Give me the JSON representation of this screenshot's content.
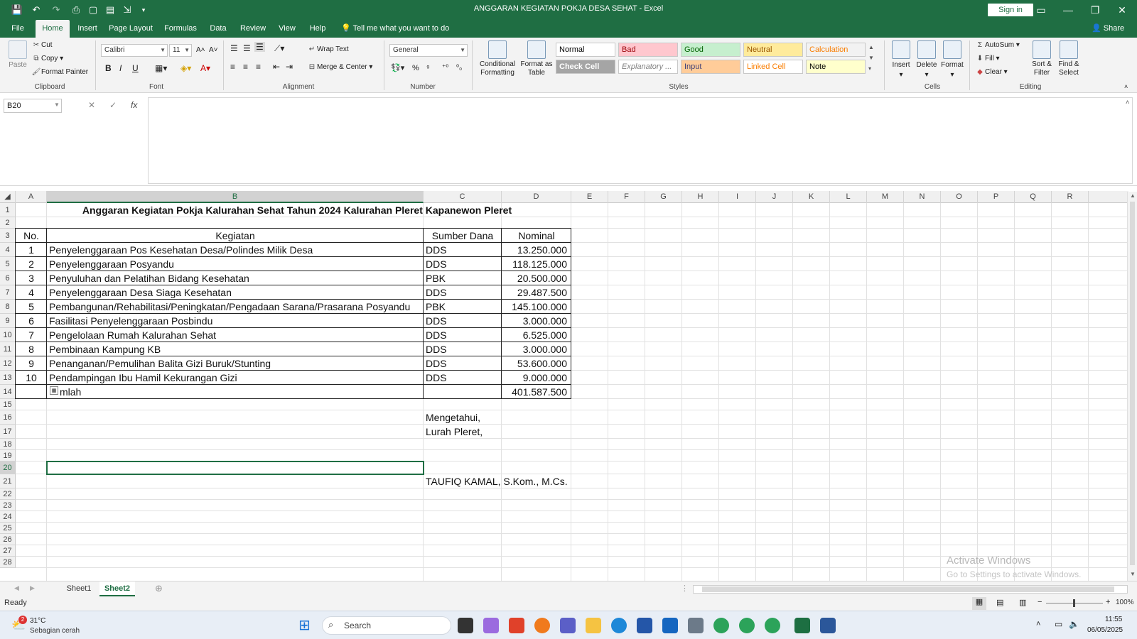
{
  "titlebar": {
    "title": "ANGGARAN KEGIATAN POKJA DESA SEHAT  -  Excel",
    "signin": "Sign in"
  },
  "tabs": [
    "File",
    "Home",
    "Insert",
    "Page Layout",
    "Formulas",
    "Data",
    "Review",
    "View",
    "Help"
  ],
  "active_tab": "Home",
  "tellme": "Tell me what you want to do",
  "share": "Share",
  "ribbon": {
    "clipboard": {
      "label": "Clipboard",
      "paste": "Paste",
      "cut": "Cut",
      "copy": "Copy",
      "format_painter": "Format Painter"
    },
    "font": {
      "label": "Font",
      "name": "Calibri",
      "size": "11",
      "bold": "B",
      "italic": "I",
      "underline": "U"
    },
    "alignment": {
      "label": "Alignment",
      "wrap": "Wrap Text",
      "merge": "Merge & Center"
    },
    "number": {
      "label": "Number",
      "format": "General"
    },
    "styles": {
      "label": "Styles",
      "conditional": "Conditional Formatting",
      "format_table": "Format as Table",
      "cells": [
        {
          "name": "Normal",
          "bg": "#ffffff",
          "color": "#000000"
        },
        {
          "name": "Bad",
          "bg": "#ffc7ce",
          "color": "#9c0006"
        },
        {
          "name": "Good",
          "bg": "#c6efce",
          "color": "#006100"
        },
        {
          "name": "Neutral",
          "bg": "#ffeb9c",
          "color": "#9c5700"
        },
        {
          "name": "Calculation",
          "bg": "#f2f2f2",
          "color": "#fa7d00"
        },
        {
          "name": "Check Cell",
          "bg": "#a5a5a5",
          "color": "#ffffff"
        },
        {
          "name": "Explanatory ...",
          "bg": "#ffffff",
          "color": "#7f7f7f"
        },
        {
          "name": "Input",
          "bg": "#ffcc99",
          "color": "#3f3f76"
        },
        {
          "name": "Linked Cell",
          "bg": "#ffffff",
          "color": "#fa7d00"
        },
        {
          "name": "Note",
          "bg": "#ffffcc",
          "color": "#000000"
        }
      ]
    },
    "cells": {
      "label": "Cells",
      "insert": "Insert",
      "delete": "Delete",
      "format": "Format"
    },
    "editing": {
      "label": "Editing",
      "autosum": "AutoSum",
      "fill": "Fill",
      "clear": "Clear",
      "sort": "Sort & Filter",
      "find": "Find & Select"
    }
  },
  "namebox": "B20",
  "columns": [
    "A",
    "B",
    "C",
    "D",
    "E",
    "F",
    "G",
    "H",
    "I",
    "J",
    "K",
    "L",
    "M",
    "N",
    "O",
    "P",
    "Q",
    "R"
  ],
  "selected_col": "B",
  "selected_row": 20,
  "rows": [
    "1",
    "2",
    "3",
    "4",
    "5",
    "6",
    "7",
    "8",
    "9",
    "10",
    "11",
    "12",
    "13",
    "14",
    "15",
    "16",
    "17",
    "18",
    "19",
    "20",
    "21",
    "22",
    "23",
    "24",
    "25",
    "26",
    "27",
    "28"
  ],
  "sheet": {
    "title": "Anggaran Kegiatan Pokja Kalurahan Sehat Tahun 2024 Kalurahan Pleret Kapanewon Pleret",
    "headers": {
      "no": "No.",
      "kegiatan": "Kegiatan",
      "sumber": "Sumber Dana",
      "nominal": "Nominal"
    },
    "items": [
      {
        "no": "1",
        "kegiatan": "Penyelenggaraan Pos Kesehatan Desa/Polindes Milik Desa",
        "sumber": "DDS",
        "nominal": "13.250.000"
      },
      {
        "no": "2",
        "kegiatan": "Penyelenggaraan Posyandu",
        "sumber": "DDS",
        "nominal": "118.125.000"
      },
      {
        "no": "3",
        "kegiatan": "Penyuluhan dan Pelatihan Bidang Kesehatan",
        "sumber": "PBK",
        "nominal": "20.500.000"
      },
      {
        "no": "4",
        "kegiatan": "Penyelenggaraan Desa Siaga Kesehatan",
        "sumber": "DDS",
        "nominal": "29.487.500"
      },
      {
        "no": "5",
        "kegiatan": "Pembangunan/Rehabilitasi/Peningkatan/Pengadaan Sarana/Prasarana Posyandu",
        "sumber": "PBK",
        "nominal": "145.100.000"
      },
      {
        "no": "6",
        "kegiatan": "Fasilitasi Penyelenggaraan Posbindu",
        "sumber": "DDS",
        "nominal": "3.000.000"
      },
      {
        "no": "7",
        "kegiatan": "Pengelolaan Rumah Kalurahan Sehat",
        "sumber": "DDS",
        "nominal": "6.525.000"
      },
      {
        "no": "8",
        "kegiatan": "Pembinaan Kampung KB",
        "sumber": "DDS",
        "nominal": "3.000.000"
      },
      {
        "no": "9",
        "kegiatan": "Penanganan/Pemulihan Balita Gizi Buruk/Stunting",
        "sumber": "DDS",
        "nominal": "53.600.000"
      },
      {
        "no": "10",
        "kegiatan": "Pendampingan Ibu Hamil Kekurangan Gizi",
        "sumber": "DDS",
        "nominal": "9.000.000"
      }
    ],
    "total_label": "mlah",
    "total": "401.587.500",
    "mengetahui": "Mengetahui,",
    "lurah": "Lurah Pleret,",
    "signer": "TAUFIQ KAMAL, S.Kom., M.Cs."
  },
  "watermark": {
    "line1": "Activate Windows",
    "line2": "Go to Settings to activate Windows."
  },
  "sheet_tabs": [
    "Sheet1",
    "Sheet2"
  ],
  "active_sheet": "Sheet2",
  "status": "Ready",
  "zoom": "100%",
  "taskbar": {
    "temp": "31°C",
    "weather": "Sebagian cerah",
    "badge": "2",
    "search": "Search",
    "time": "11:55",
    "date": "06/05/2025"
  }
}
